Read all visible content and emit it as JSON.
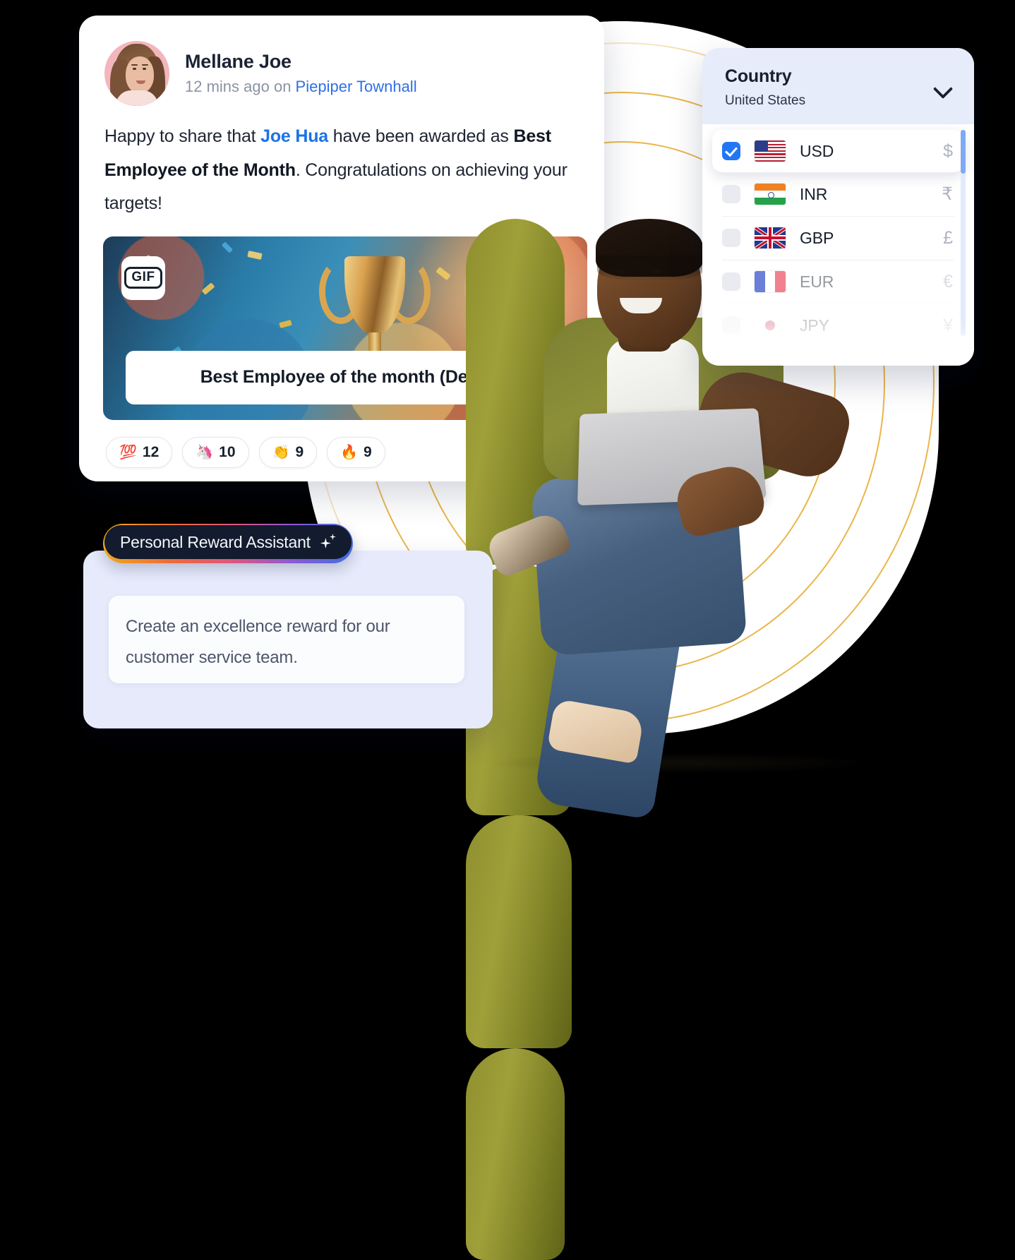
{
  "post": {
    "author": "Mellane Joe",
    "meta_time": "12 mins ago on ",
    "meta_channel": "Piepiper Townhall",
    "body_part1": "Happy to share that ",
    "body_mention": "Joe Hua",
    "body_part2": " have been awarded as ",
    "body_bold": "Best Employee of the Month",
    "body_part3": ". Congratulations on achieving your targets!",
    "gif_badge_label": "GIF",
    "gif_caption": "Best Employee of the month (Dec)",
    "reactions": [
      {
        "emoji": "💯",
        "name": "hundred-points-reaction",
        "count": "12"
      },
      {
        "emoji": "🦄",
        "name": "unicorn-reaction",
        "count": "10"
      },
      {
        "emoji": "👏",
        "name": "clap-reaction",
        "count": "9"
      },
      {
        "emoji": "🔥",
        "name": "fire-reaction",
        "count": "9"
      }
    ]
  },
  "country_card": {
    "title": "Country",
    "selected_country": "United States",
    "chevron_icon": "chevron-down-icon",
    "currencies": [
      {
        "code": "USD",
        "symbol": "$",
        "flag": "us-flag-icon",
        "checked": true
      },
      {
        "code": "INR",
        "symbol": "₹",
        "flag": "in-flag-icon",
        "checked": false
      },
      {
        "code": "GBP",
        "symbol": "£",
        "flag": "gb-flag-icon",
        "checked": false
      },
      {
        "code": "EUR",
        "symbol": "€",
        "flag": "eu-flag-icon",
        "checked": false
      },
      {
        "code": "JPY",
        "symbol": "¥",
        "flag": "jp-flag-icon",
        "checked": false
      }
    ]
  },
  "assistant": {
    "pill_label": "Personal Reward Assistant",
    "sparkle_icon": "sparkle-icon",
    "prompt_text": "Create an excellence reward for our customer service team."
  },
  "colors": {
    "link_blue": "#2f6fe4",
    "mention_blue": "#1a73e8",
    "checkbox_blue": "#2176f3",
    "card_header_lavender": "#e7ecfb",
    "assistant_panel_lavender": "#e6eafb",
    "scrollbar_thumb": "#7fa9f3",
    "arc_gold": "#e9b64a",
    "pouf_green": "#8e8f2e"
  }
}
